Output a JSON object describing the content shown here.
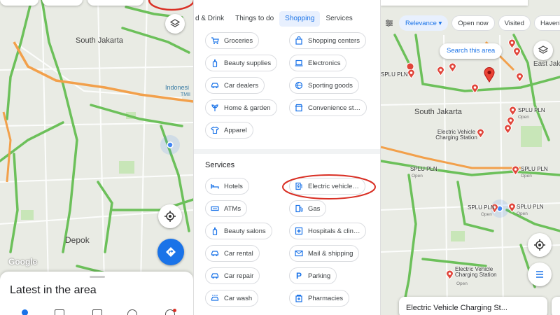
{
  "panel_left": {
    "map_labels": {
      "south_jakarta": "South Jakarta",
      "depok": "Depok",
      "indonesia_frag": "Indonesi",
      "tmii": "TMII"
    },
    "google_logo": "Google",
    "bottom_sheet_title": "Latest in the area"
  },
  "panel_middle": {
    "tabs": [
      "d & Drink",
      "Things to do",
      "Shopping",
      "Services"
    ],
    "active_tab": "Shopping",
    "shopping_items": [
      {
        "label": "Groceries",
        "icon": "cart-icon"
      },
      {
        "label": "Shopping centers",
        "icon": "shopping-bag-icon"
      },
      {
        "label": "Beauty supplies",
        "icon": "bottle-icon"
      },
      {
        "label": "Electronics",
        "icon": "laptop-icon"
      },
      {
        "label": "Car dealers",
        "icon": "car-icon"
      },
      {
        "label": "Sporting goods",
        "icon": "ball-icon"
      },
      {
        "label": "Home & garden",
        "icon": "plant-icon"
      },
      {
        "label": "Convenience st…",
        "icon": "store-icon"
      },
      {
        "label": "Apparel",
        "icon": "shirt-icon"
      }
    ],
    "services_title": "Services",
    "service_items": [
      {
        "label": "Hotels",
        "icon": "bed-icon"
      },
      {
        "label": "Electric vehicle…",
        "icon": "ev-charging-icon"
      },
      {
        "label": "ATMs",
        "icon": "atm-icon"
      },
      {
        "label": "Gas",
        "icon": "gas-pump-icon"
      },
      {
        "label": "Beauty salons",
        "icon": "bottle-icon"
      },
      {
        "label": "Hospitals & clin…",
        "icon": "hospital-icon"
      },
      {
        "label": "Car rental",
        "icon": "car-rental-icon"
      },
      {
        "label": "Mail & shipping",
        "icon": "mail-icon"
      },
      {
        "label": "Car repair",
        "icon": "wrench-icon"
      },
      {
        "label": "Parking",
        "icon": "parking-icon"
      },
      {
        "label": "Car wash",
        "icon": "car-wash-icon"
      },
      {
        "label": "Pharmacies",
        "icon": "pharmacy-icon"
      }
    ]
  },
  "panel_right": {
    "filters": [
      "Relevance ▾",
      "Open now",
      "Visited",
      "Haven't"
    ],
    "search_this_area": "Search this area",
    "map_labels": {
      "east_jak": "East Jak",
      "south_jakarta": "South Jakarta"
    },
    "pins": [
      {
        "label": "SPLU PLN",
        "sub": ""
      },
      {
        "label": "SPLU PLN",
        "sub": "Open"
      },
      {
        "label": "Electric Vehicle Charging Station",
        "sub": ""
      },
      {
        "label": "SPLU PLN",
        "sub": "Open"
      },
      {
        "label": "SPLU PLN",
        "sub": "Open"
      },
      {
        "label": "SPLU PLN",
        "sub": "Open"
      },
      {
        "label": "SPLU PLN",
        "sub": "Open"
      },
      {
        "label": "Electric Vehicle Charging Station",
        "sub": "Open"
      }
    ],
    "result_card_title": "Electric Vehicle Charging St..."
  },
  "colors": {
    "accent_blue": "#1a73e8",
    "highlight_red": "#d93025",
    "road_green": "#6cc05a",
    "road_orange": "#f2a04b",
    "pin_red": "#e0453a"
  }
}
